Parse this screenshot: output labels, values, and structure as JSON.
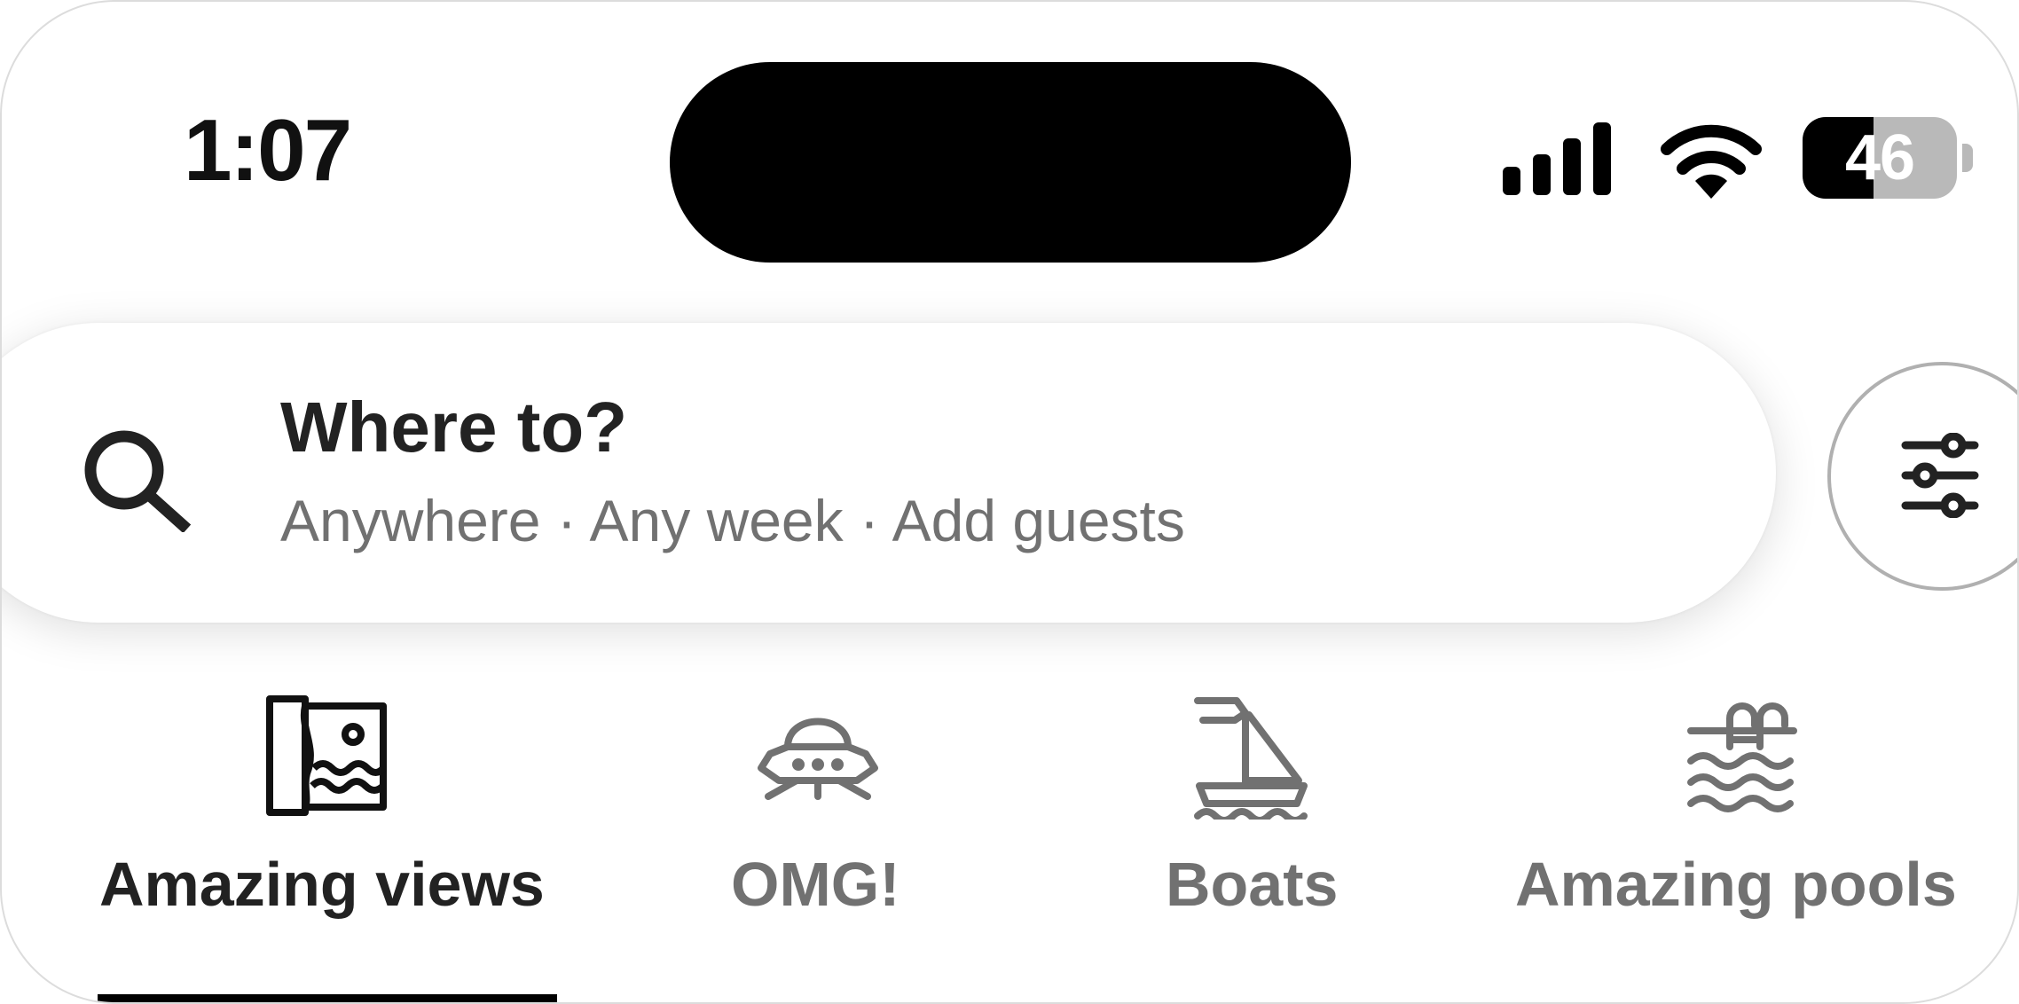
{
  "status_bar": {
    "time": "1:07",
    "battery": "46",
    "battery_level": 0.46,
    "icons": [
      "cellular-signal-icon",
      "wifi-icon",
      "battery-icon"
    ]
  },
  "search": {
    "title": "Where to?",
    "subtitle": "Anywhere · Any week · Add guests",
    "icon": "search-icon",
    "filter_icon": "sliders-icon"
  },
  "categories": [
    {
      "label": "Amazing views",
      "icon": "framed-view-icon",
      "selected": true
    },
    {
      "label": "OMG!",
      "icon": "ufo-icon",
      "selected": false
    },
    {
      "label": "Boats",
      "icon": "sailboat-icon",
      "selected": false
    },
    {
      "label": "Amazing pools",
      "icon": "pool-ladder-icon",
      "selected": false
    }
  ],
  "colors": {
    "selected_text": "#222222",
    "unselected_text": "#717171",
    "subtitle_text": "#717171"
  }
}
